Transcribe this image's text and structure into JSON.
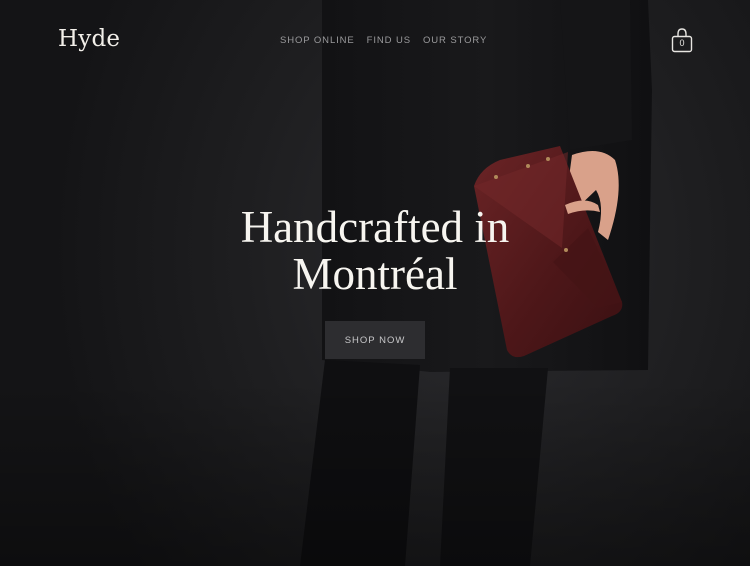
{
  "brand": {
    "logo_text": "Hyde"
  },
  "nav": {
    "items": [
      {
        "label": "SHOP ONLINE"
      },
      {
        "label": "FIND US"
      },
      {
        "label": "OUR STORY"
      }
    ]
  },
  "cart": {
    "icon": "shopping-bag-icon",
    "count": "0"
  },
  "hero": {
    "headline_line1": "Handcrafted in",
    "headline_line2": "Montréal",
    "cta_label": "SHOP NOW",
    "image": "model-holding-leather-clutch"
  },
  "colors": {
    "background": "#1a1a1c",
    "text": "#f7f5f0",
    "nav_text": "#9a9a9c",
    "button_bg": "#2d2d30",
    "bag_leather": "#5a1c1e"
  }
}
